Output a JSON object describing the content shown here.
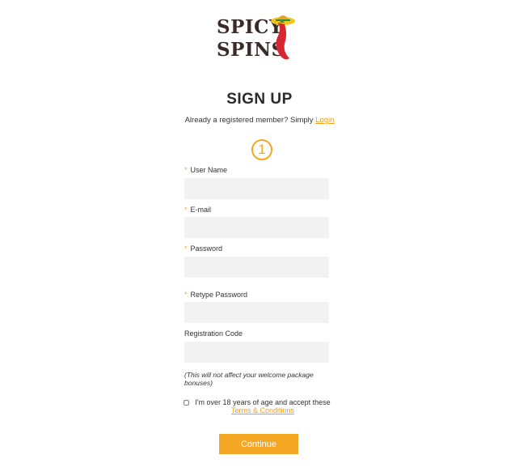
{
  "logo": {
    "line1": "SPICY",
    "line2": "SPINS"
  },
  "page_title": "SIGN UP",
  "login_prompt": {
    "text": "Already a registered member? Simply ",
    "link": "Login"
  },
  "step_number": "1",
  "fields": [
    {
      "label": "User Name",
      "required": "*",
      "value": "",
      "placeholder": ""
    },
    {
      "label": "E-mail",
      "required": "*",
      "value": "",
      "placeholder": ""
    },
    {
      "label": "Password",
      "required": "*",
      "value": "",
      "placeholder": ""
    },
    {
      "label": "Retype Password",
      "required": "*",
      "value": "",
      "placeholder": ""
    },
    {
      "label": "Registration Code",
      "value": "",
      "placeholder": ""
    }
  ],
  "code_note": "(This will not affect your welcome package bonuses)",
  "agreement": {
    "text": "I'm over 18 years of age and accept these",
    "link": "Terms & Conditions",
    "checked": false
  },
  "continue_label": "Continue",
  "colors": {
    "accent": "#f5a623",
    "field_bg": "#f2f2f2",
    "text": "#333333"
  }
}
